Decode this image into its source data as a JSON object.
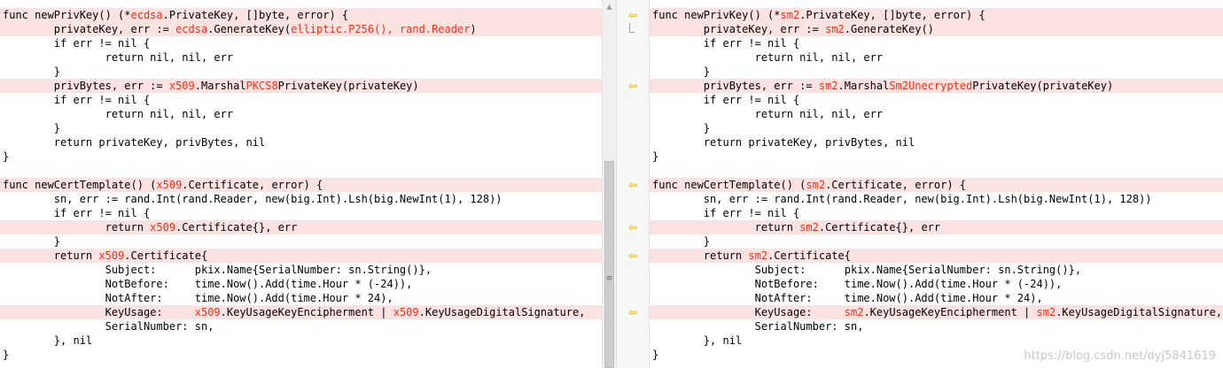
{
  "colors": {
    "diff_bg": "#fde2e2",
    "highlight": "#e8321c",
    "arrow": "#d4a200"
  },
  "icons": {
    "merge_arrow": "merge-left-arrow-icon",
    "scroll_up": "scroll-up-arrow-icon",
    "grip": "thumb-grip-icon"
  },
  "scrollbar": {
    "up_glyph": "▲",
    "grip_glyph": "≡"
  },
  "gutter": {
    "arrow_glyph": "⇦",
    "arrow_rows": [
      0,
      5,
      12,
      15,
      17,
      21
    ]
  },
  "watermark": "https://blog.csdn.net/dyj5841619",
  "left": {
    "lines": [
      {
        "diff": true,
        "segs": [
          [
            "func newPrivKey() (*",
            0
          ],
          [
            "ecdsa",
            1
          ],
          [
            ".PrivateKey, []byte, error) {",
            0
          ]
        ]
      },
      {
        "diff": true,
        "segs": [
          [
            "        privateKey, err := ",
            0
          ],
          [
            "ecdsa",
            1
          ],
          [
            ".GenerateKey(",
            0
          ],
          [
            "elliptic.P256(), rand.Reader",
            1
          ],
          [
            ")",
            0
          ]
        ]
      },
      {
        "diff": false,
        "segs": [
          [
            "        if err != nil {",
            0
          ]
        ]
      },
      {
        "diff": false,
        "segs": [
          [
            "                return nil, nil, err",
            0
          ]
        ]
      },
      {
        "diff": false,
        "segs": [
          [
            "        }",
            0
          ]
        ]
      },
      {
        "diff": true,
        "segs": [
          [
            "        privBytes, err := ",
            0
          ],
          [
            "x509",
            1
          ],
          [
            ".Marshal",
            0
          ],
          [
            "PKCS8",
            1
          ],
          [
            "PrivateKey(privateKey)",
            0
          ]
        ]
      },
      {
        "diff": false,
        "segs": [
          [
            "        if err != nil {",
            0
          ]
        ]
      },
      {
        "diff": false,
        "segs": [
          [
            "                return nil, nil, err",
            0
          ]
        ]
      },
      {
        "diff": false,
        "segs": [
          [
            "        }",
            0
          ]
        ]
      },
      {
        "diff": false,
        "segs": [
          [
            "        return privateKey, privBytes, nil",
            0
          ]
        ]
      },
      {
        "diff": false,
        "segs": [
          [
            "}",
            0
          ]
        ]
      },
      {
        "diff": false,
        "segs": [
          [
            "",
            0
          ]
        ]
      },
      {
        "diff": true,
        "segs": [
          [
            "func newCertTemplate() (",
            0
          ],
          [
            "x509",
            1
          ],
          [
            ".Certificate, error) {",
            0
          ]
        ]
      },
      {
        "diff": false,
        "segs": [
          [
            "        sn, err := rand.Int(rand.Reader, new(big.Int).Lsh(big.NewInt(1), 128))",
            0
          ]
        ]
      },
      {
        "diff": false,
        "segs": [
          [
            "        if err != nil {",
            0
          ]
        ]
      },
      {
        "diff": true,
        "segs": [
          [
            "                return ",
            0
          ],
          [
            "x509",
            1
          ],
          [
            ".Certificate{}, err",
            0
          ]
        ]
      },
      {
        "diff": false,
        "segs": [
          [
            "        }",
            0
          ]
        ]
      },
      {
        "diff": true,
        "segs": [
          [
            "        return ",
            0
          ],
          [
            "x509",
            1
          ],
          [
            ".Certificate{",
            0
          ]
        ]
      },
      {
        "diff": false,
        "segs": [
          [
            "                Subject:      pkix.Name{SerialNumber: sn.String()},",
            0
          ]
        ]
      },
      {
        "diff": false,
        "segs": [
          [
            "                NotBefore:    time.Now().Add(time.Hour * (-24)),",
            0
          ]
        ]
      },
      {
        "diff": false,
        "segs": [
          [
            "                NotAfter:     time.Now().Add(time.Hour * 24),",
            0
          ]
        ]
      },
      {
        "diff": true,
        "segs": [
          [
            "                KeyUsage:     ",
            0
          ],
          [
            "x509",
            1
          ],
          [
            ".KeyUsageKeyEncipherment | ",
            0
          ],
          [
            "x509",
            1
          ],
          [
            ".KeyUsageDigitalSignature,",
            0
          ]
        ]
      },
      {
        "diff": false,
        "segs": [
          [
            "                SerialNumber: sn,",
            0
          ]
        ]
      },
      {
        "diff": false,
        "segs": [
          [
            "        }, nil",
            0
          ]
        ]
      },
      {
        "diff": false,
        "segs": [
          [
            "}",
            0
          ]
        ]
      }
    ]
  },
  "right": {
    "lines": [
      {
        "diff": true,
        "segs": [
          [
            "func newPrivKey() (*",
            0
          ],
          [
            "sm2",
            1
          ],
          [
            ".PrivateKey, []byte, error) {",
            0
          ]
        ]
      },
      {
        "diff": true,
        "segs": [
          [
            "        privateKey, err := ",
            0
          ],
          [
            "sm2",
            1
          ],
          [
            ".GenerateKey()",
            0
          ]
        ]
      },
      {
        "diff": false,
        "segs": [
          [
            "        if err != nil {",
            0
          ]
        ]
      },
      {
        "diff": false,
        "segs": [
          [
            "                return nil, nil, err",
            0
          ]
        ]
      },
      {
        "diff": false,
        "segs": [
          [
            "        }",
            0
          ]
        ]
      },
      {
        "diff": true,
        "segs": [
          [
            "        privBytes, err := ",
            0
          ],
          [
            "sm2",
            1
          ],
          [
            ".Marshal",
            0
          ],
          [
            "Sm2Unecrypted",
            1
          ],
          [
            "PrivateKey(privateKey)",
            0
          ]
        ]
      },
      {
        "diff": false,
        "segs": [
          [
            "        if err != nil {",
            0
          ]
        ]
      },
      {
        "diff": false,
        "segs": [
          [
            "                return nil, nil, err",
            0
          ]
        ]
      },
      {
        "diff": false,
        "segs": [
          [
            "        }",
            0
          ]
        ]
      },
      {
        "diff": false,
        "segs": [
          [
            "        return privateKey, privBytes, nil",
            0
          ]
        ]
      },
      {
        "diff": false,
        "segs": [
          [
            "}",
            0
          ]
        ]
      },
      {
        "diff": false,
        "segs": [
          [
            "",
            0
          ]
        ]
      },
      {
        "diff": true,
        "segs": [
          [
            "func newCertTemplate() (",
            0
          ],
          [
            "sm2",
            1
          ],
          [
            ".Certificate, error) {",
            0
          ]
        ]
      },
      {
        "diff": false,
        "segs": [
          [
            "        sn, err := rand.Int(rand.Reader, new(big.Int).Lsh(big.NewInt(1), 128))",
            0
          ]
        ]
      },
      {
        "diff": false,
        "segs": [
          [
            "        if err != nil {",
            0
          ]
        ]
      },
      {
        "diff": true,
        "segs": [
          [
            "                return ",
            0
          ],
          [
            "sm2",
            1
          ],
          [
            ".Certificate{}, err",
            0
          ]
        ]
      },
      {
        "diff": false,
        "segs": [
          [
            "        }",
            0
          ]
        ]
      },
      {
        "diff": true,
        "segs": [
          [
            "        return ",
            0
          ],
          [
            "sm2",
            1
          ],
          [
            ".Certificate{",
            0
          ]
        ]
      },
      {
        "diff": false,
        "segs": [
          [
            "                Subject:      pkix.Name{SerialNumber: sn.String()},",
            0
          ]
        ]
      },
      {
        "diff": false,
        "segs": [
          [
            "                NotBefore:    time.Now().Add(time.Hour * (-24)),",
            0
          ]
        ]
      },
      {
        "diff": false,
        "segs": [
          [
            "                NotAfter:     time.Now().Add(time.Hour * 24),",
            0
          ]
        ]
      },
      {
        "diff": true,
        "segs": [
          [
            "                KeyUsage:     ",
            0
          ],
          [
            "sm2",
            1
          ],
          [
            ".KeyUsageKeyEncipherment | ",
            0
          ],
          [
            "sm2",
            1
          ],
          [
            ".KeyUsageDigitalSignature,",
            0
          ]
        ]
      },
      {
        "diff": false,
        "segs": [
          [
            "                SerialNumber: sn,",
            0
          ]
        ]
      },
      {
        "diff": false,
        "segs": [
          [
            "        }, nil",
            0
          ]
        ]
      },
      {
        "diff": false,
        "segs": [
          [
            "}",
            0
          ]
        ]
      }
    ]
  }
}
